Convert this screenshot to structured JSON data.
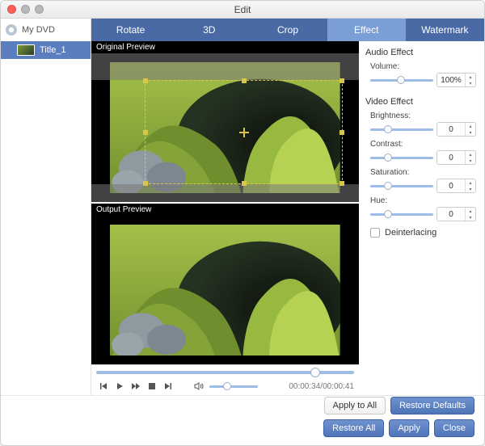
{
  "window": {
    "title": "Edit"
  },
  "sidebar": {
    "root": "My DVD",
    "items": [
      {
        "label": "Title_1"
      }
    ]
  },
  "tabs": [
    {
      "id": "rotate",
      "label": "Rotate"
    },
    {
      "id": "3d",
      "label": "3D"
    },
    {
      "id": "crop",
      "label": "Crop"
    },
    {
      "id": "effect",
      "label": "Effect",
      "active": true
    },
    {
      "id": "watermark",
      "label": "Watermark"
    }
  ],
  "preview": {
    "original_label": "Original Preview",
    "output_label": "Output Preview",
    "current_time": "00:00:34",
    "total_time": "00:00:41",
    "progress_pct": 83,
    "volume_pct": 28
  },
  "effects": {
    "audio_section": "Audio Effect",
    "video_section": "Video Effect",
    "volume": {
      "label": "Volume:",
      "value": "100%",
      "pct": 42
    },
    "brightness": {
      "label": "Brightness:",
      "value": "0",
      "pct": 22
    },
    "contrast": {
      "label": "Contrast:",
      "value": "0",
      "pct": 22
    },
    "saturation": {
      "label": "Saturation:",
      "value": "0",
      "pct": 22
    },
    "hue": {
      "label": "Hue:",
      "value": "0",
      "pct": 22
    },
    "deinterlacing": {
      "label": "Deinterlacing",
      "checked": false
    }
  },
  "buttons": {
    "apply_all": "Apply to All",
    "restore_defaults": "Restore Defaults",
    "restore_all": "Restore All",
    "apply": "Apply",
    "close": "Close"
  }
}
